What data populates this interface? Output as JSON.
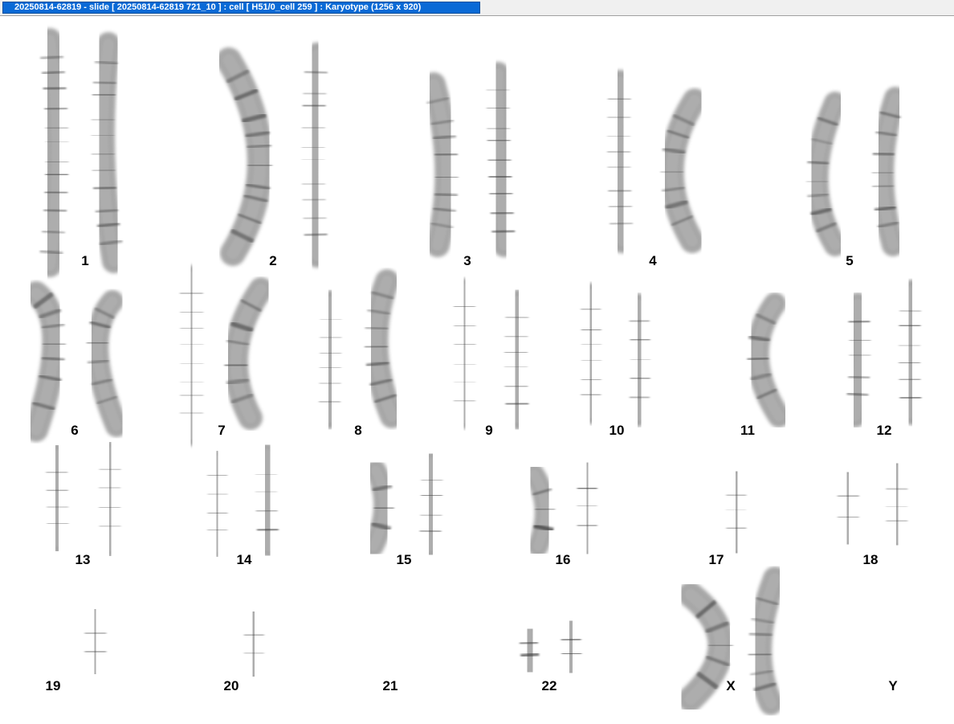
{
  "window": {
    "title": "20250814-62819 - slide [ 20250814-62819 721_10 ] : cell [ H51/0_cell 259 ] : Karyotype  (1256 x 920)"
  },
  "karyotype": {
    "labels": [
      "1",
      "2",
      "3",
      "4",
      "5",
      "6",
      "7",
      "8",
      "9",
      "10",
      "11",
      "12",
      "13",
      "14",
      "15",
      "16",
      "17",
      "18",
      "19",
      "20",
      "21",
      "22",
      "X",
      "Y"
    ]
  },
  "colors": {
    "background": "#ffffff",
    "titlebar_bg": "#0a6ad6",
    "titlebar_text": "#ffffff",
    "chromosome": "#8a8a8a",
    "band": "#3a3a3a"
  },
  "icons": {
    "chromosome": "chromosome-banded-icon"
  }
}
